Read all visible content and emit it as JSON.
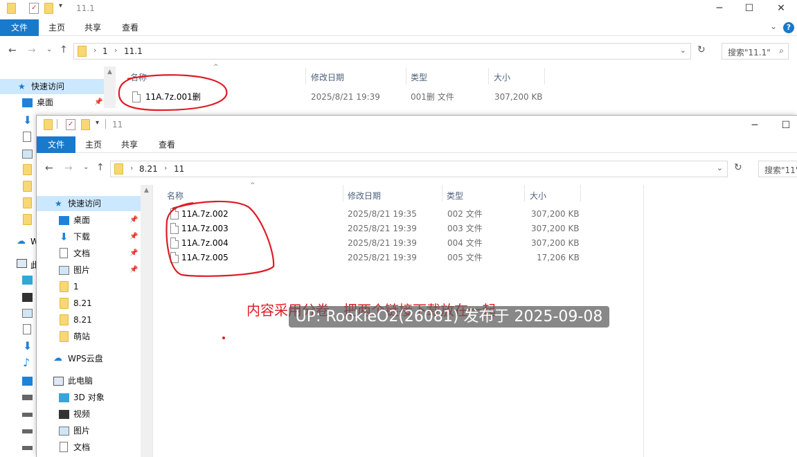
{
  "back_window": {
    "title": "11.1",
    "ribbon_tabs": [
      "文件",
      "主页",
      "共享",
      "查看"
    ],
    "breadcrumb": [
      "1",
      "11.1"
    ],
    "search_placeholder": "搜索\"11.1\"",
    "columns": {
      "name": "名称",
      "date": "修改日期",
      "type": "类型",
      "size": "大小"
    },
    "files": [
      {
        "name": "11A.7z.001删",
        "date": "2025/8/21 19:39",
        "type": "001删 文件",
        "size": "307,200 KB"
      }
    ],
    "nav": {
      "quick_access": "快速访问",
      "desktop": "桌面",
      "partial": "W",
      "partial2": "此"
    }
  },
  "front_window": {
    "title": "11",
    "ribbon_tabs": [
      "文件",
      "主页",
      "共享",
      "查看"
    ],
    "breadcrumb": [
      "8.21",
      "11"
    ],
    "search_placeholder": "搜索\"11\"",
    "columns": {
      "name": "名称",
      "date": "修改日期",
      "type": "类型",
      "size": "大小"
    },
    "files": [
      {
        "name": "11A.7z.002",
        "date": "2025/8/21 19:35",
        "type": "002 文件",
        "size": "307,200 KB"
      },
      {
        "name": "11A.7z.003",
        "date": "2025/8/21 19:39",
        "type": "003 文件",
        "size": "307,200 KB"
      },
      {
        "name": "11A.7z.004",
        "date": "2025/8/21 19:39",
        "type": "004 文件",
        "size": "307,200 KB"
      },
      {
        "name": "11A.7z.005",
        "date": "2025/8/21 19:39",
        "type": "005 文件",
        "size": "17,206 KB"
      }
    ],
    "nav": {
      "quick_access": "快速访问",
      "items": [
        "桌面",
        "下载",
        "文档",
        "图片",
        "1",
        "8.21",
        "8.21",
        "萌站"
      ],
      "wps": "WPS云盘",
      "this_pc": "此电脑",
      "pc_items": [
        "3D 对象",
        "视频",
        "图片",
        "文档"
      ]
    }
  },
  "annotation_text": "内容采用分卷，把两个链接下载放在一起",
  "watermark": "UP: RookieO2(26081) 发布于 2025-09-08",
  "colors": {
    "accent": "#1979ca",
    "annotation": "#e01b24",
    "folder": "#f8d775"
  }
}
